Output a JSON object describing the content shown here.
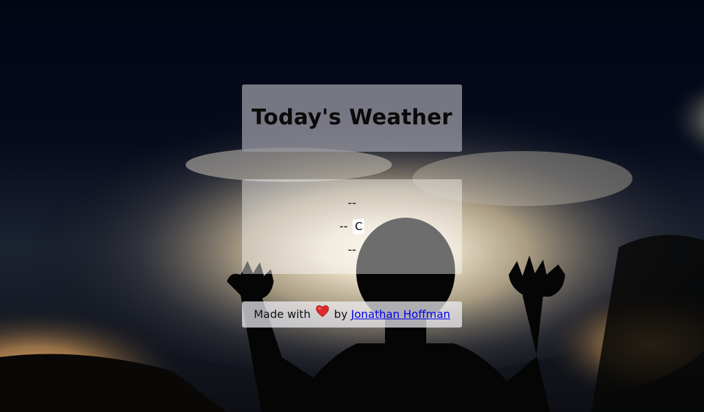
{
  "header": {
    "title": "Today's Weather"
  },
  "weather": {
    "location": "--",
    "temperature": "--",
    "unit_button": "C",
    "condition": "--"
  },
  "footer": {
    "made_with": "Made with",
    "by": "by",
    "author_link": "Jonathan Hoffman",
    "heart_icon": "heart-icon"
  },
  "colors": {
    "title_card_bg": "#9696a0",
    "link": "#0000ee",
    "heart": "#e0282e"
  }
}
